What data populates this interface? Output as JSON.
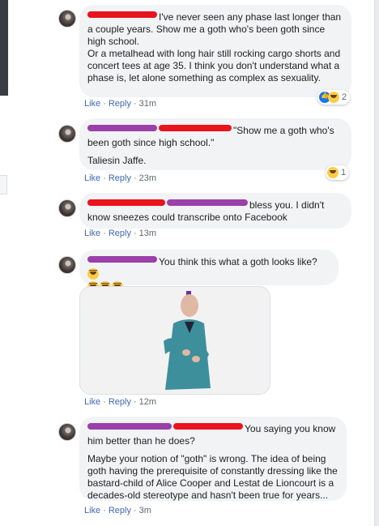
{
  "comments": [
    {
      "text": "I've never seen any phase last longer than a couple years. Show me a goth who's been goth since high school.",
      "text2": "Or a metalhead with long hair still rocking cargo shorts and concert tees at age 35. I think you don't understand what a phase is, let alone something as complex as sexuality.",
      "like_label": "Like",
      "reply_label": "Reply",
      "time": "31m",
      "reaction_count": "2"
    },
    {
      "text": "\"Show me a goth who's been goth since high school.\"",
      "text2": "Taliesin Jaffe.",
      "like_label": "Like",
      "reply_label": "Reply",
      "time": "23m",
      "reaction_count": "1"
    },
    {
      "text": "bless you. I didn't know sneezes could transcribe onto Facebook",
      "like_label": "Like",
      "reply_label": "Reply",
      "time": "13m"
    },
    {
      "text": "You think this what a goth looks like?",
      "like_label": "Like",
      "reply_label": "Reply",
      "time": "12m"
    },
    {
      "text": "You saying you know him better than he does?",
      "text2": "Maybe your notion of \"goth\" is wrong. The idea of being goth having the prerequisite of constantly dressing like the bastard-child of Alice Cooper and Lestat de Lioncourt is a decades-old stereotype and hasn't been true for years...",
      "like_label": "Like",
      "reply_label": "Reply",
      "time": "3m"
    }
  ],
  "colors": {
    "bubble": "#f2f3f5",
    "link": "#4267b2",
    "redaction_red": "#e8141e",
    "redaction_purple": "#9b3fa9"
  }
}
